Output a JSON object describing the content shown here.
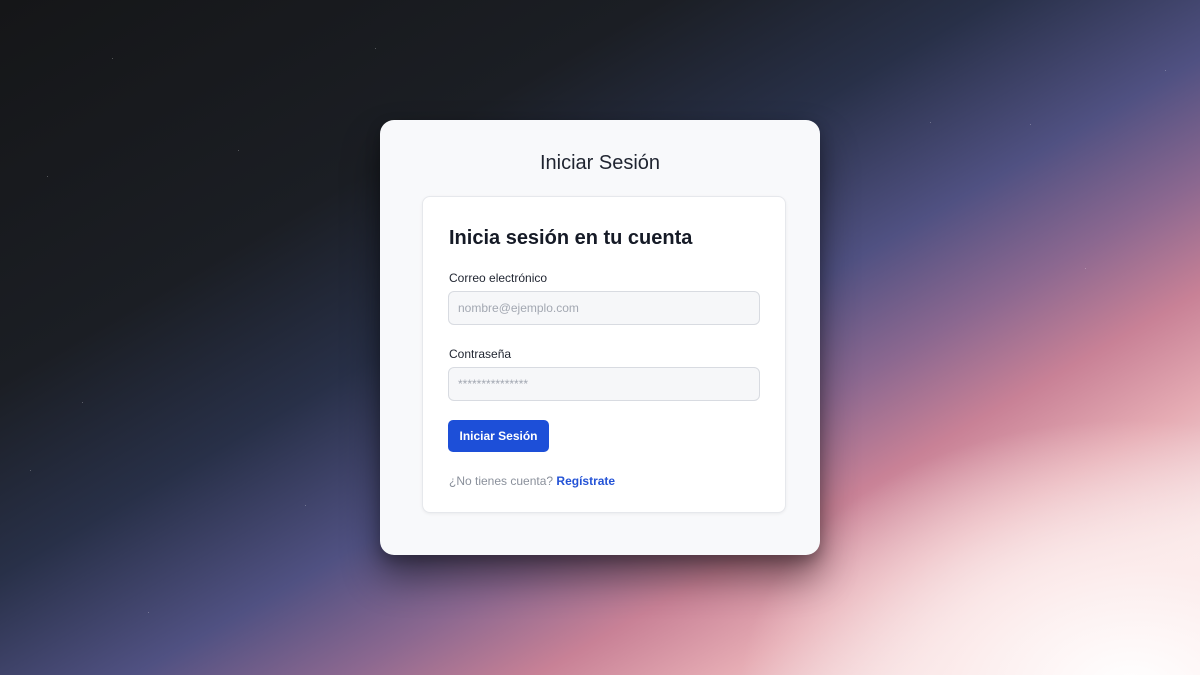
{
  "card": {
    "title": "Iniciar Sesión"
  },
  "form": {
    "heading": "Inicia sesión en tu cuenta",
    "email_label": "Correo electrónico",
    "email_placeholder": "nombre@ejemplo.com",
    "email_value": "",
    "password_label": "Contraseña",
    "password_placeholder": "***************",
    "password_value": "",
    "submit_label": "Iniciar Sesión",
    "signup_prompt": "¿No tienes cuenta?",
    "signup_link": "Regístrate"
  },
  "colors": {
    "accent": "#1d4fd8",
    "link": "#2453d6",
    "card_bg": "#f8f9fb"
  }
}
